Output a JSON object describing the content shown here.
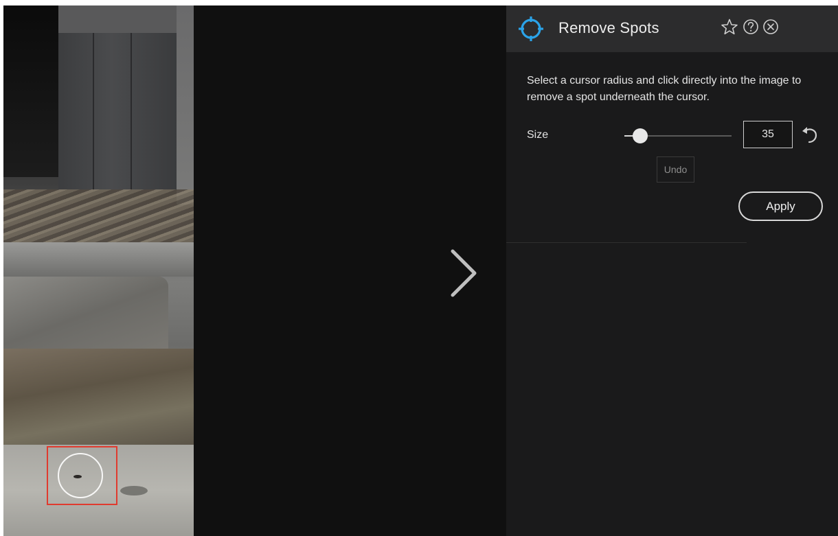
{
  "panel": {
    "title": "Remove Spots",
    "instructions": "Select a cursor radius and click directly into the image to remove a spot underneath the cursor.",
    "size": {
      "label": "Size",
      "value": "35",
      "slider_fraction": 0.15
    },
    "undo_label": "Undo",
    "apply_label": "Apply"
  },
  "icons": {
    "header": "crosshair-target-icon",
    "favorite": "star-icon",
    "help": "question-circle-icon",
    "close": "close-circle-icon",
    "reset": "reset-arrow-icon",
    "next": "chevron-right-icon"
  },
  "colors": {
    "accent": "#2ba3e8",
    "marker": "#e03a2e",
    "panel_bg": "#1a1a1b",
    "header_bg": "#2c2c2d"
  }
}
